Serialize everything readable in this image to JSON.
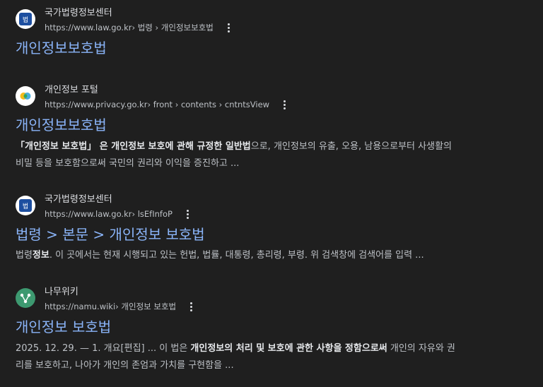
{
  "results": [
    {
      "site_name": "국가법령정보센터",
      "url_base": "https://www.law.go.kr",
      "url_path": " › 법령 › 개인정보보호법",
      "title": "개인정보보호법",
      "favicon": "law-go-kr-icon"
    },
    {
      "site_name": "개인정보 포털",
      "url_base": "https://www.privacy.go.kr",
      "url_path": " › front › contents › cntntsView",
      "title": "개인정보보호법",
      "favicon": "privacy-portal-icon",
      "snippet": {
        "line1_bold_a": "「개인정보 보호법」 은 개인정보 보호에 관해 규정한 일반법",
        "line1_rest": "으로, 개인정보의 유출, 오용, 남용으로부터 사생활의",
        "line2": "비밀 등을 보호함으로써 국민의 권리와 이익을 증진하고 ..."
      }
    },
    {
      "site_name": "국가법령정보센터",
      "url_base": "https://www.law.go.kr",
      "url_path": " › lsEfInfoP",
      "title": "법령 > 본문 > 개인정보 보호법",
      "favicon": "law-go-kr-icon",
      "snippet": {
        "pre": "법령",
        "bold": "정보",
        "post": ". 이 곳에서는 현재 시행되고 있는 헌법, 법률, 대통령, 총리령, 부령. 위 검색창에 검색어를 입력 ..."
      }
    },
    {
      "site_name": "나무위키",
      "url_base": "https://namu.wiki",
      "url_path": " › 개인정보 보호법",
      "title": "개인정보 보호법",
      "favicon": "namu-wiki-icon",
      "snippet": {
        "pre": "2025. 12. 29. — 1. 개요[편집] ... 이 법은 ",
        "bold": "개인정보의 처리 및 보호에 관한 사항을 정함으로써",
        "post": " 개인의 자유와 권",
        "line2": "리를 보호하고, 나아가 개인의 존엄과 가치를 구현함을 ..."
      }
    }
  ],
  "colors": {
    "background": "#1f1f1f",
    "title_link": "#8ab4f8",
    "site_name": "#dadce0",
    "url": "#bdc1c6",
    "snippet": "#bdc1c6",
    "law_icon_blue": "#1d4fa0",
    "namu_green": "#3d9970"
  }
}
